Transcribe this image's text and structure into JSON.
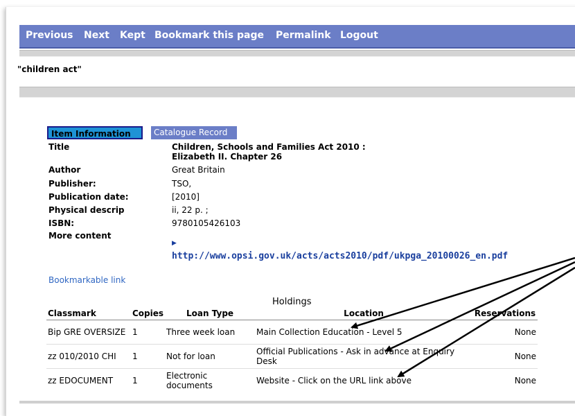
{
  "nav": {
    "previous": "Previous",
    "next": "Next",
    "kept": "Kept",
    "bookmark": "Bookmark this page",
    "permalink": "Permalink",
    "logout": "Logout"
  },
  "search": {
    "query": "\"children act\""
  },
  "tabs": {
    "item_info": "Item Information",
    "catalogue": "Catalogue Record"
  },
  "record": {
    "title_label": "Title",
    "title_line1": "Children, Schools and Families Act 2010 :",
    "title_line2": "Elizabeth II. Chapter 26",
    "author_label": "Author",
    "author": "Great Britain",
    "publisher_label": "Publisher:",
    "publisher": "TSO,",
    "pubdate_label": "Publication date:",
    "pubdate": "[2010]",
    "physical_label": "Physical descrip",
    "physical": "ii, 22 p. ;",
    "isbn_label": "ISBN:",
    "isbn": "9780105426103",
    "more_label": "More content",
    "more_url": "http://www.opsi.gov.uk/acts/acts2010/pdf/ukpga_20100026_en.pdf"
  },
  "bookmarkable_link": "Bookmarkable link",
  "holdings": {
    "caption": "Holdings",
    "headers": [
      "Classmark",
      "Copies",
      "Loan Type",
      "Location",
      "Reservations"
    ],
    "rows": [
      [
        "Bip GRE OVERSIZE",
        "1",
        "Three week loan",
        "Main Collection Education - Level 5",
        "None"
      ],
      [
        "zz 010/2010 CHI",
        "1",
        "Not for loan",
        "Official Publications - Ask in advance at Enquiry Desk",
        "None"
      ],
      [
        "zz EDOCUMENT",
        "1",
        "Electronic documents",
        "Website - Click on the URL link above",
        "None"
      ]
    ]
  },
  "colors": {
    "nav_bg": "#6b7ec7",
    "tab_active": "#1e93d6",
    "link": "#1a3f9e"
  }
}
